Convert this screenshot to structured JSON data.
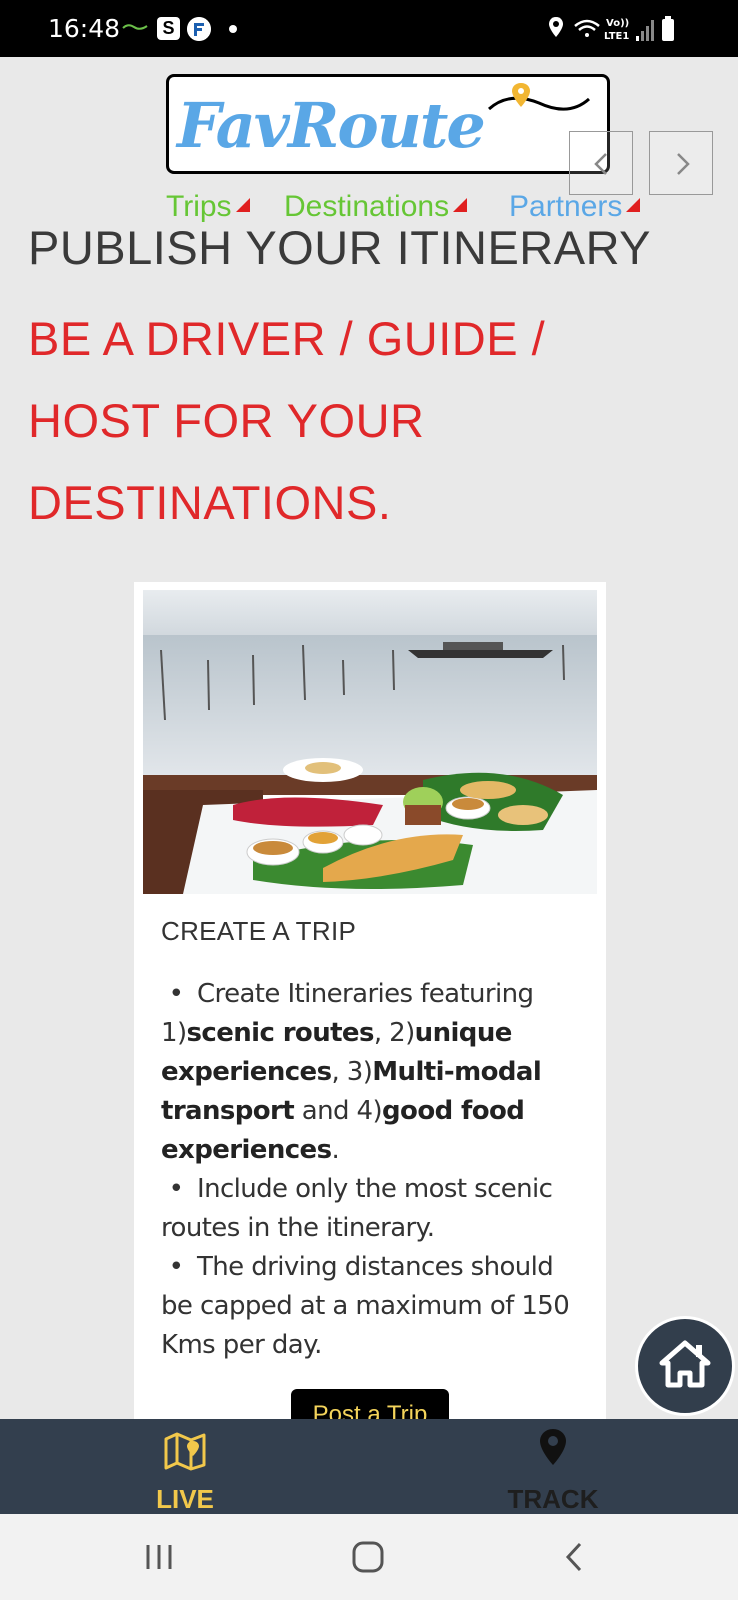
{
  "status_bar": {
    "time": "16:48",
    "notification_icons": [
      "favroute-mini-icon",
      "s-app-icon",
      "f-app-icon",
      "more-dot"
    ],
    "system_icons": [
      "location-icon",
      "wifi-icon",
      "volte-icon",
      "signal-icon",
      "battery-icon"
    ],
    "volte_label": "Vo))",
    "lte_label": "LTE1"
  },
  "header": {
    "logo_text": "FavRoute",
    "nav": [
      {
        "label": "Trips"
      },
      {
        "label": "Destinations"
      },
      {
        "label": "Partners"
      }
    ]
  },
  "hero": {
    "headline": "PUBLISH YOUR ITINERARY",
    "subhead_lines": [
      "BE A DRIVER / GUIDE /",
      "HOST FOR YOUR",
      "DESTINATIONS."
    ]
  },
  "card": {
    "image_alt": "Breakfast on banana leaves by the backwaters",
    "title": "CREATE A TRIP",
    "bullets": {
      "b1": {
        "t1": "Create Itineraries featuring 1)",
        "s1": "scenic routes",
        "t2": ", 2)",
        "s2": "unique experiences",
        "t3": ", 3)",
        "s3": "Multi-modal transport",
        "t4": " and 4)",
        "s4": "good food experiences",
        "t5": "."
      },
      "b2": "Include only the most scenic routes in the itinerary.",
      "b3": "The driving distances should be capped at a maximum of 150 Kms per day."
    },
    "button_label": "Post a Trip"
  },
  "bottom_tabs": [
    {
      "label": "LIVE",
      "icon": "map-icon",
      "active": true,
      "color": "#f2c84b"
    },
    {
      "label": "TRACK",
      "icon": "location-pin-icon",
      "active": false,
      "color": "#1e1e1e"
    }
  ],
  "colors": {
    "accent_red": "#e0282a",
    "nav_green": "#66c635",
    "nav_blue": "#5aa7e6",
    "tabbar_bg": "#333f4e",
    "tab_active": "#f2c84b"
  }
}
